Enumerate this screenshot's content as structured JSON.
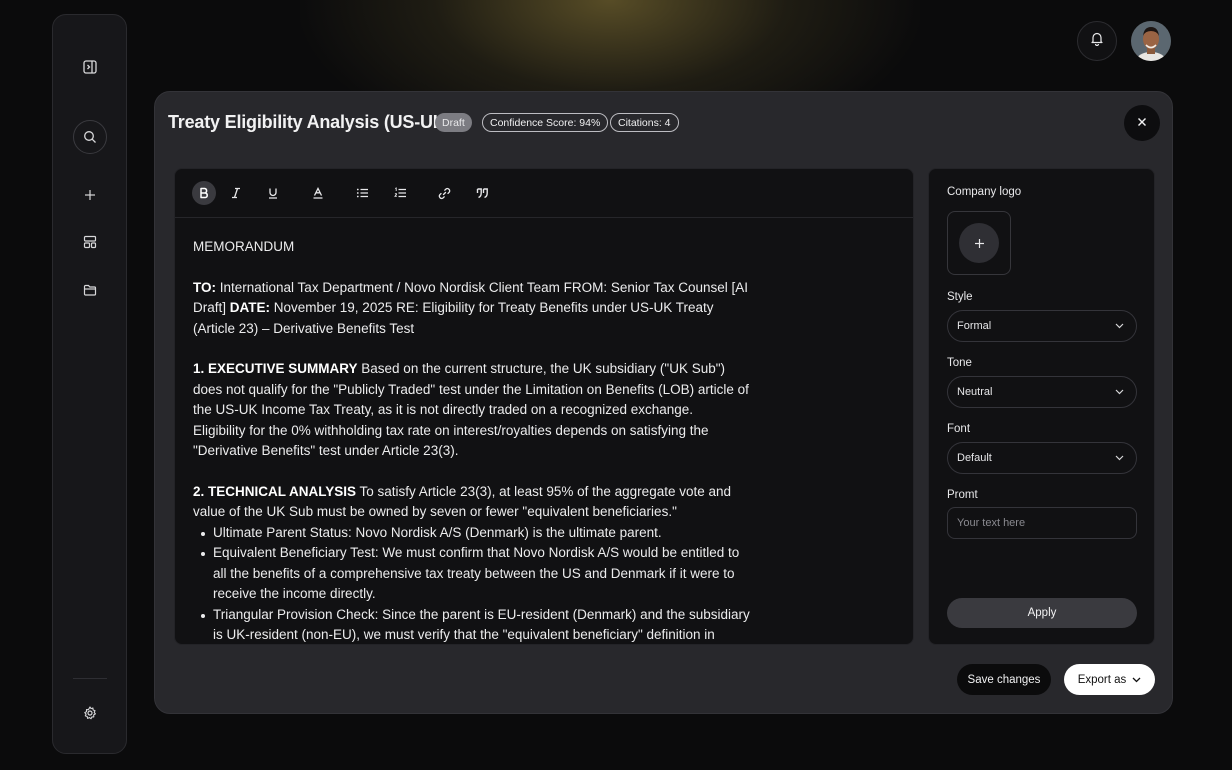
{
  "sidebar": {
    "items": [
      {
        "icon": "collapse-sidebar-icon"
      },
      {
        "icon": "search-icon"
      },
      {
        "icon": "plus-icon"
      },
      {
        "icon": "layout-icon"
      },
      {
        "icon": "folder-icon"
      },
      {
        "icon": "gear-icon"
      }
    ]
  },
  "header": {
    "bell_icon": "bell-icon",
    "avatar_icon": "user-avatar"
  },
  "modal": {
    "title": "Treaty Eligibility Analysis (US-UK)",
    "badges": {
      "status": "Draft",
      "confidence": "Confidence Score: 94%",
      "citations": "Citations: 4"
    },
    "close_icon": "close-icon"
  },
  "toolbar": {
    "tools": [
      "bold-icon",
      "italic-icon",
      "underline-icon",
      "text-color-icon",
      "bullet-list-icon",
      "numbered-list-icon",
      "link-icon",
      "quote-icon"
    ]
  },
  "document": {
    "heading": "MEMORANDUM",
    "to_label": "TO:",
    "to_text": " International Tax Department / Novo Nordisk Client Team FROM: Senior Tax Counsel [AI Draft] ",
    "date_label": "DATE:",
    "date_text": " November 19, 2025 RE: Eligibility for Treaty Benefits under US-UK Treaty (Article 23) – Derivative Benefits Test",
    "s1_label": "1. EXECUTIVE SUMMARY",
    "s1_text": " Based on the current structure, the UK subsidiary (\"UK Sub\") does not qualify for the \"Publicly Traded\" test under the Limitation on Benefits (LOB) article of the US-UK Income Tax Treaty, as it is not directly traded on a recognized exchange.",
    "s1_text2": "Eligibility for the 0% withholding tax rate on interest/royalties depends on satisfying the \"Derivative Benefits\" test under Article 23(3).",
    "s2_label": "2. TECHNICAL ANALYSIS",
    "s2_text": " To satisfy Article 23(3), at least 95% of the aggregate vote and value of the UK Sub must be owned by seven or fewer \"equivalent beneficiaries.\"",
    "bullets": [
      "Ultimate Parent Status: Novo Nordisk A/S (Denmark) is the ultimate parent.",
      "Equivalent Beneficiary Test: We must confirm that Novo Nordisk A/S would be entitled to all the benefits of a comprehensive tax treaty between the US and Denmark if it were to receive the income directly.",
      "Triangular Provision Check: Since the parent is EU-resident (Denmark) and the subsidiary is UK-resident (non-EU), we must verify that the \"equivalent beneficiary\" definition in Article"
    ]
  },
  "panel": {
    "logo_label": "Company logo",
    "style_label": "Style",
    "style_value": "Formal",
    "tone_label": "Tone",
    "tone_value": "Neutral",
    "font_label": "Font",
    "font_value": "Default",
    "prompt_label": "Promt",
    "prompt_placeholder": "Your text here",
    "apply_label": "Apply"
  },
  "footer": {
    "save_label": "Save changes",
    "export_label": "Export as"
  }
}
